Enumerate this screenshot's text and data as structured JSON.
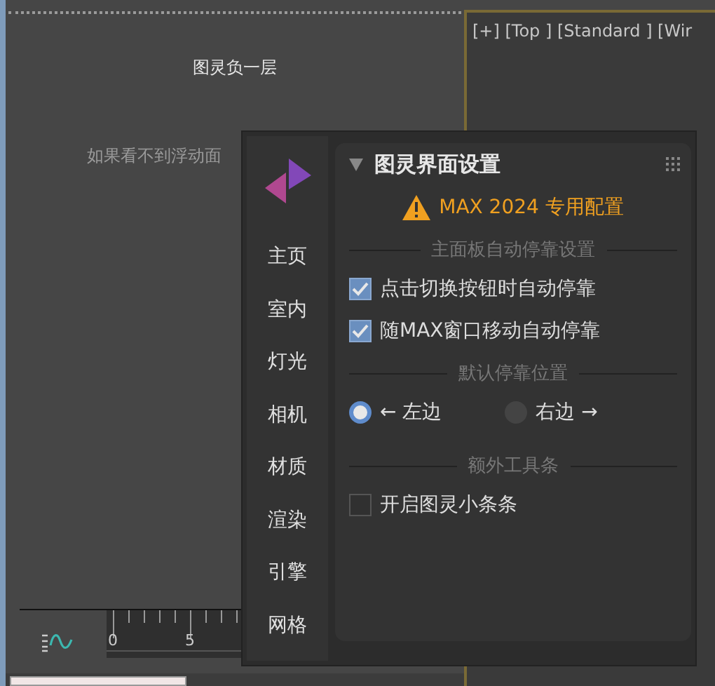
{
  "viewport": {
    "label": "[+] [Top ] [Standard ] [Wir"
  },
  "left_panel": {
    "title": "图灵负一层",
    "hint": "如果看不到浮动面"
  },
  "timeline": {
    "ticks": [
      "0",
      "5"
    ]
  },
  "floating_panel": {
    "nav": [
      "主页",
      "室内",
      "灯光",
      "相机",
      "材质",
      "渲染",
      "引擎",
      "网格"
    ],
    "section_title": "图灵界面设置",
    "warning": "MAX 2024 专用配置",
    "groups": [
      {
        "heading": "主面板自动停靠设置",
        "items": [
          {
            "kind": "checkbox",
            "label": "点击切换按钮时自动停靠",
            "checked": true
          },
          {
            "kind": "checkbox",
            "label": "随MAX窗口移动自动停靠",
            "checked": true
          }
        ]
      },
      {
        "heading": "默认停靠位置",
        "items": [
          {
            "kind": "radio",
            "label": "← 左边",
            "selected": true
          },
          {
            "kind": "radio",
            "label": "右边 →",
            "selected": false
          }
        ]
      },
      {
        "heading": "额外工具条",
        "items": [
          {
            "kind": "checkbox",
            "label": "开启图灵小条条",
            "checked": false
          }
        ]
      }
    ]
  }
}
